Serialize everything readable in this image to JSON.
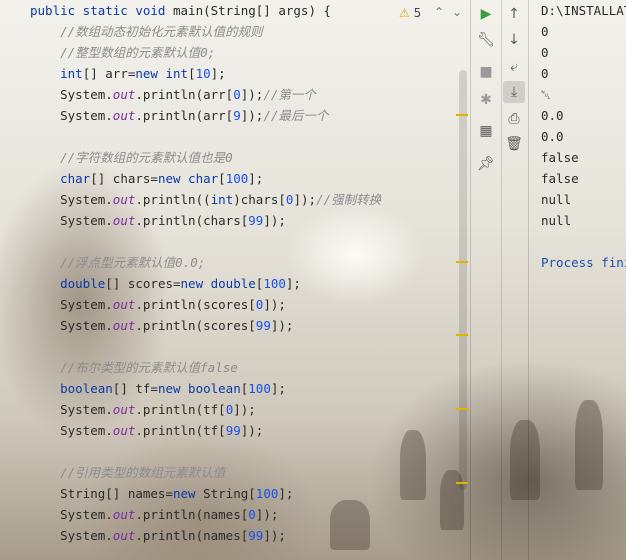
{
  "editor": {
    "code_lines": [
      {
        "parts": [
          {
            "t": "public static void ",
            "c": "kw"
          },
          {
            "t": "main(String[] args) {",
            "c": ""
          }
        ]
      },
      {
        "parts": [
          {
            "t": "    //数组动态初始化元素默认值的规则",
            "c": "cm"
          }
        ]
      },
      {
        "parts": [
          {
            "t": "    //整型数组的元素默认值0;",
            "c": "cm"
          }
        ]
      },
      {
        "parts": [
          {
            "t": "    ",
            "c": ""
          },
          {
            "t": "int",
            "c": "kw"
          },
          {
            "t": "[] arr=",
            "c": ""
          },
          {
            "t": "new int",
            "c": "kw"
          },
          {
            "t": "[",
            "c": ""
          },
          {
            "t": "10",
            "c": "num"
          },
          {
            "t": "];",
            "c": ""
          }
        ]
      },
      {
        "parts": [
          {
            "t": "    System.",
            "c": ""
          },
          {
            "t": "out",
            "c": "fld"
          },
          {
            "t": ".println(arr[",
            "c": ""
          },
          {
            "t": "0",
            "c": "num"
          },
          {
            "t": "]);",
            "c": ""
          },
          {
            "t": "//第一个",
            "c": "cm"
          }
        ]
      },
      {
        "parts": [
          {
            "t": "    System.",
            "c": ""
          },
          {
            "t": "out",
            "c": "fld"
          },
          {
            "t": ".println(arr[",
            "c": ""
          },
          {
            "t": "9",
            "c": "num"
          },
          {
            "t": "]);",
            "c": ""
          },
          {
            "t": "//最后一个",
            "c": "cm"
          }
        ]
      },
      {
        "parts": []
      },
      {
        "parts": [
          {
            "t": "    //字符数组的元素默认值也是0",
            "c": "cm"
          }
        ]
      },
      {
        "parts": [
          {
            "t": "    ",
            "c": ""
          },
          {
            "t": "char",
            "c": "kw"
          },
          {
            "t": "[] chars=",
            "c": ""
          },
          {
            "t": "new char",
            "c": "kw"
          },
          {
            "t": "[",
            "c": ""
          },
          {
            "t": "100",
            "c": "num"
          },
          {
            "t": "];",
            "c": ""
          }
        ]
      },
      {
        "parts": [
          {
            "t": "    System.",
            "c": ""
          },
          {
            "t": "out",
            "c": "fld"
          },
          {
            "t": ".println((",
            "c": ""
          },
          {
            "t": "int",
            "c": "kw"
          },
          {
            "t": ")chars[",
            "c": ""
          },
          {
            "t": "0",
            "c": "num"
          },
          {
            "t": "]);",
            "c": ""
          },
          {
            "t": "//强制转换",
            "c": "cm"
          }
        ]
      },
      {
        "parts": [
          {
            "t": "    System.",
            "c": ""
          },
          {
            "t": "out",
            "c": "fld"
          },
          {
            "t": ".println(chars[",
            "c": ""
          },
          {
            "t": "99",
            "c": "num"
          },
          {
            "t": "]);",
            "c": ""
          }
        ]
      },
      {
        "parts": []
      },
      {
        "parts": [
          {
            "t": "    //浮点型元素默认值0.0;",
            "c": "cm"
          }
        ]
      },
      {
        "parts": [
          {
            "t": "    ",
            "c": ""
          },
          {
            "t": "double",
            "c": "kw"
          },
          {
            "t": "[] scores=",
            "c": ""
          },
          {
            "t": "new double",
            "c": "kw"
          },
          {
            "t": "[",
            "c": ""
          },
          {
            "t": "100",
            "c": "num"
          },
          {
            "t": "];",
            "c": ""
          }
        ]
      },
      {
        "parts": [
          {
            "t": "    System.",
            "c": ""
          },
          {
            "t": "out",
            "c": "fld"
          },
          {
            "t": ".println(scores[",
            "c": ""
          },
          {
            "t": "0",
            "c": "num"
          },
          {
            "t": "]);",
            "c": ""
          }
        ]
      },
      {
        "parts": [
          {
            "t": "    System.",
            "c": ""
          },
          {
            "t": "out",
            "c": "fld"
          },
          {
            "t": ".println(scores[",
            "c": ""
          },
          {
            "t": "99",
            "c": "num"
          },
          {
            "t": "]);",
            "c": ""
          }
        ]
      },
      {
        "parts": []
      },
      {
        "parts": [
          {
            "t": "    //布尔类型的元素默认值false",
            "c": "cm"
          }
        ]
      },
      {
        "parts": [
          {
            "t": "    ",
            "c": ""
          },
          {
            "t": "boolean",
            "c": "kw"
          },
          {
            "t": "[] tf=",
            "c": ""
          },
          {
            "t": "new boolean",
            "c": "kw"
          },
          {
            "t": "[",
            "c": ""
          },
          {
            "t": "100",
            "c": "num"
          },
          {
            "t": "];",
            "c": ""
          }
        ]
      },
      {
        "parts": [
          {
            "t": "    System.",
            "c": ""
          },
          {
            "t": "out",
            "c": "fld"
          },
          {
            "t": ".println(tf[",
            "c": ""
          },
          {
            "t": "0",
            "c": "num"
          },
          {
            "t": "]);",
            "c": ""
          }
        ]
      },
      {
        "parts": [
          {
            "t": "    System.",
            "c": ""
          },
          {
            "t": "out",
            "c": "fld"
          },
          {
            "t": ".println(tf[",
            "c": ""
          },
          {
            "t": "99",
            "c": "num"
          },
          {
            "t": "]);",
            "c": ""
          }
        ]
      },
      {
        "parts": []
      },
      {
        "parts": [
          {
            "t": "    //引用类型的数组元素默认值",
            "c": "cm"
          }
        ]
      },
      {
        "parts": [
          {
            "t": "    String[] names=",
            "c": ""
          },
          {
            "t": "new ",
            "c": "kw"
          },
          {
            "t": "String[",
            "c": ""
          },
          {
            "t": "100",
            "c": "num"
          },
          {
            "t": "];",
            "c": ""
          }
        ]
      },
      {
        "parts": [
          {
            "t": "    System.",
            "c": ""
          },
          {
            "t": "out",
            "c": "fld"
          },
          {
            "t": ".println(names[",
            "c": ""
          },
          {
            "t": "0",
            "c": "num"
          },
          {
            "t": "]);",
            "c": ""
          }
        ]
      },
      {
        "parts": [
          {
            "t": "    System.",
            "c": ""
          },
          {
            "t": "out",
            "c": "fld"
          },
          {
            "t": ".println(names[",
            "c": ""
          },
          {
            "t": "99",
            "c": "num"
          },
          {
            "t": "]);",
            "c": ""
          }
        ]
      }
    ],
    "warning_count": "5",
    "warning_icon": "warning-triangle-icon"
  },
  "run_toolbar": {
    "icons": [
      "run-icon",
      "wrench-icon",
      "stop-icon",
      "debug-icon",
      "layout-icon",
      "pin-icon"
    ]
  },
  "console_toolbar": {
    "icons": [
      "arrow-up-icon",
      "arrow-down-icon",
      "soft-wrap-icon",
      "scroll-to-end-icon",
      "print-icon",
      "trash-icon"
    ]
  },
  "console": {
    "lines": [
      "D:\\INSTALLAT",
      "0",
      "0",
      "0",
      "\u0000",
      "0.0",
      "0.0",
      "false",
      "false",
      "null",
      "null",
      "",
      "Process fini"
    ]
  },
  "colors": {
    "keyword": "#0a3aa8",
    "field": "#7a2fa0",
    "number": "#1750eb",
    "comment": "#8c8c8c",
    "console_process": "#1a4fb0",
    "warning": "#e0a800",
    "run_green": "#3f9b3f"
  }
}
